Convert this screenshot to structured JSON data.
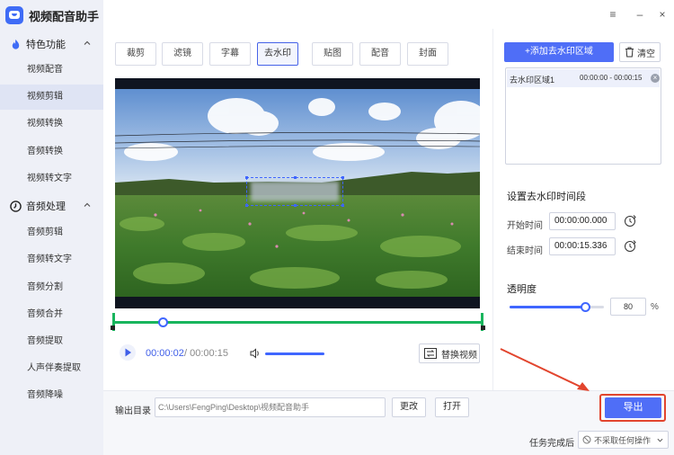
{
  "app": {
    "title": "视频配音助手"
  },
  "window_controls": {
    "menu": "≡",
    "minimize": "–",
    "close": "×"
  },
  "sidebar": {
    "sections": [
      {
        "label": "特色功能",
        "icon": "flame-icon"
      },
      {
        "label": "音频处理",
        "icon": "clock-icon"
      }
    ],
    "feature_items": [
      "视频配音",
      "视频剪辑",
      "视频转换",
      "音频转换",
      "视频转文字"
    ],
    "audio_items": [
      "音频剪辑",
      "音频转文字",
      "音频分割",
      "音频合并",
      "音频提取",
      "人声伴奏提取",
      "音频降噪"
    ],
    "active_item": "视频剪辑"
  },
  "tabs": [
    "裁剪",
    "滤镜",
    "字幕",
    "去水印",
    "贴图",
    "配音",
    "封面"
  ],
  "active_tab": "去水印",
  "player": {
    "current_time": "00:00:02",
    "total_time": "/ 00:00:15",
    "replace_label": "替换视频",
    "progress": 0.13
  },
  "watermark_panel": {
    "add_label": "+添加去水印区域",
    "clear_label": "清空",
    "regions": [
      {
        "name": "去水印区域1",
        "time": "00:00:00 - 00:00:15"
      }
    ],
    "time_title": "设置去水印时间段",
    "start_label": "开始时间",
    "start_value": "00:00:00.000",
    "end_label": "结束时间",
    "end_value": "00:00:15.336",
    "opacity_title": "透明度",
    "opacity_value": "80",
    "opacity_unit": "%",
    "opacity": 0.8
  },
  "bottom": {
    "output_label": "输出目录",
    "output_path": "C:\\Users\\FengPing\\Desktop\\视频配音助手",
    "change_label": "更改",
    "open_label": "打开",
    "export_label": "导出",
    "task_label": "任务完成后",
    "task_value": "不采取任何操作"
  },
  "colors": {
    "accent": "#4f6ef7",
    "highlight": "#e2452e",
    "track": "#19b55d"
  }
}
